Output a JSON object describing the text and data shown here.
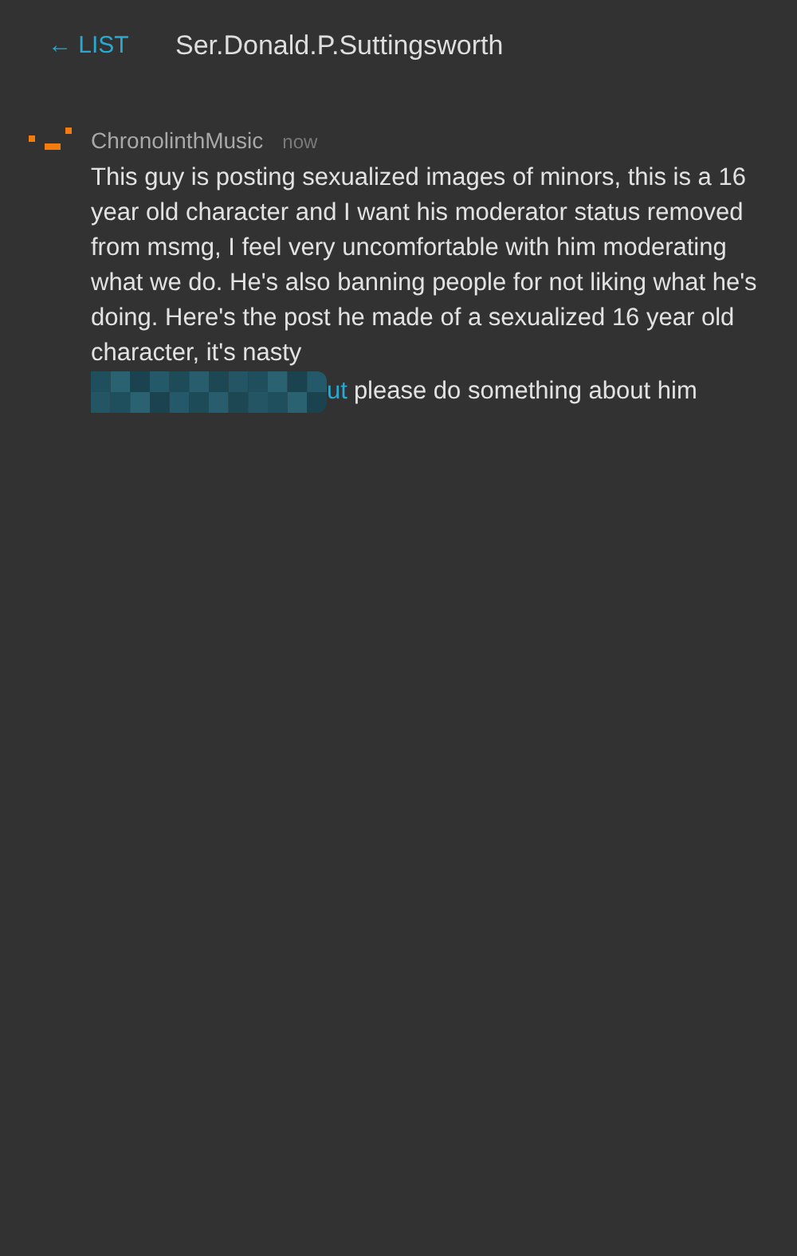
{
  "header": {
    "back_label": "← LIST",
    "title": "Ser.Donald.P.Suttingsworth"
  },
  "messages": [
    {
      "author": "ChronolinthMusic",
      "time": "now",
      "text": "This guy is posting sexualized images of minors, this is a 16 year old character and I want his moderator status removed from msmg, I feel very uncomfortable with him moderating what we do. He's also banning people for not liking what he's doing. Here's the post he made of a sexualized 16 year old character, it's nasty",
      "link_text": "ut",
      "after_link": "please do something about him"
    }
  ]
}
